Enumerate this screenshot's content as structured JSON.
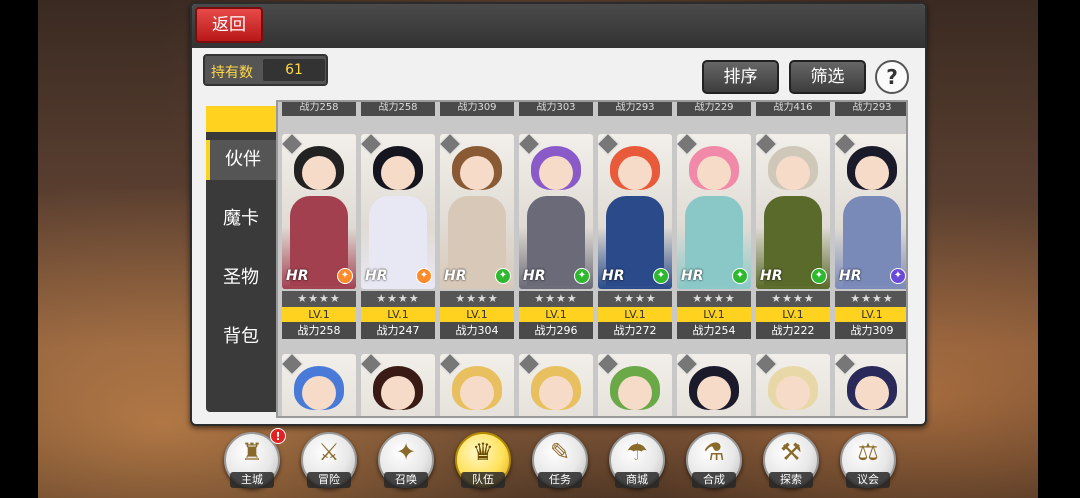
{
  "header": {
    "back_label": "返回"
  },
  "owned": {
    "label": "持有数",
    "value": "61"
  },
  "buttons": {
    "sort": "排序",
    "filter": "筛选",
    "help": "?"
  },
  "tabs": [
    {
      "label": "伙伴",
      "active": true
    },
    {
      "label": "魔卡",
      "active": false
    },
    {
      "label": "圣物",
      "active": false
    },
    {
      "label": "背包",
      "active": false
    }
  ],
  "peek_row": [
    "战力258",
    "战力258",
    "战力309",
    "战力303",
    "战力293",
    "战力229",
    "战力416",
    "战力293"
  ],
  "cards_row1": [
    {
      "stars": "★★★★",
      "level": "LV.1",
      "power": "战力258",
      "hr": "HR",
      "class_icon": "sword-icon",
      "class_color": "#ff8a2a",
      "hair": "#222222",
      "outfit": "#a34050"
    },
    {
      "stars": "★★★★",
      "level": "LV.1",
      "power": "战力247",
      "hr": "HR",
      "class_icon": "staff-icon",
      "class_color": "#ff8a2a",
      "hair": "#15151f",
      "outfit": "#e8e8f4"
    },
    {
      "stars": "★★★★",
      "level": "LV.1",
      "power": "战力304",
      "hr": "HR",
      "class_icon": "leaf-icon",
      "class_color": "#2fb82f",
      "hair": "#8a5a35",
      "outfit": "#d8c8b8"
    },
    {
      "stars": "★★★★",
      "level": "LV.1",
      "power": "战力296",
      "hr": "HR",
      "class_icon": "leaf-icon",
      "class_color": "#2fb82f",
      "hair": "#8a5ac8",
      "outfit": "#6a6a78"
    },
    {
      "stars": "★★★★",
      "level": "LV.1",
      "power": "战力272",
      "hr": "HR",
      "class_icon": "bow-icon",
      "class_color": "#2fb82f",
      "hair": "#e85a3a",
      "outfit": "#2a4a8a"
    },
    {
      "stars": "★★★★",
      "level": "LV.1",
      "power": "战力254",
      "hr": "HR",
      "class_icon": "sword-icon",
      "class_color": "#2fb82f",
      "hair": "#f08aa8",
      "outfit": "#8ac8c8"
    },
    {
      "stars": "★★★★",
      "level": "LV.1",
      "power": "战力222",
      "hr": "HR",
      "class_icon": "sword-icon",
      "class_color": "#2fb82f",
      "hair": "#cfc8b8",
      "outfit": "#5a6a2a"
    },
    {
      "stars": "★★★★",
      "level": "LV.1",
      "power": "战力309",
      "hr": "HR",
      "class_icon": "magic-icon",
      "class_color": "#6a4ad8",
      "hair": "#1a1a2a",
      "outfit": "#7a8ab8"
    }
  ],
  "cards_row2": [
    {
      "hair": "#4a7ad8",
      "outfit": "#3a3a9a"
    },
    {
      "hair": "#3a1a15",
      "outfit": "#c8a8a8"
    },
    {
      "hair": "#e8c060",
      "outfit": "#8a5a35"
    },
    {
      "hair": "#e8c060",
      "outfit": "#6a8ab8"
    },
    {
      "hair": "#6aa848",
      "outfit": "#3a6a3a"
    },
    {
      "hair": "#1a1a2a",
      "outfit": "#8a2a35"
    },
    {
      "hair": "#e8d8a8",
      "outfit": "#4a4a4a"
    },
    {
      "hair": "#2a2a5a",
      "outfit": "#5a5a8a"
    }
  ],
  "nav": [
    {
      "label": "主城",
      "glyph": "♜",
      "icon": "castle-icon",
      "badge": "!",
      "active": false
    },
    {
      "label": "冒险",
      "glyph": "⚔",
      "icon": "crossed-swords-icon",
      "badge": "",
      "active": false
    },
    {
      "label": "召唤",
      "glyph": "✦",
      "icon": "summon-card-icon",
      "badge": "",
      "active": false
    },
    {
      "label": "队伍",
      "glyph": "♛",
      "icon": "team-helmet-icon",
      "badge": "",
      "active": true
    },
    {
      "label": "任务",
      "glyph": "✎",
      "icon": "quest-scroll-icon",
      "badge": "",
      "active": false
    },
    {
      "label": "商城",
      "glyph": "☂",
      "icon": "shop-tent-icon",
      "badge": "",
      "active": false
    },
    {
      "label": "合成",
      "glyph": "⚗",
      "icon": "crafting-icon",
      "badge": "",
      "active": false
    },
    {
      "label": "探索",
      "glyph": "⚒",
      "icon": "explore-icon",
      "badge": "",
      "active": false
    },
    {
      "label": "议会",
      "glyph": "⚖",
      "icon": "council-icon",
      "badge": "",
      "active": false
    }
  ]
}
